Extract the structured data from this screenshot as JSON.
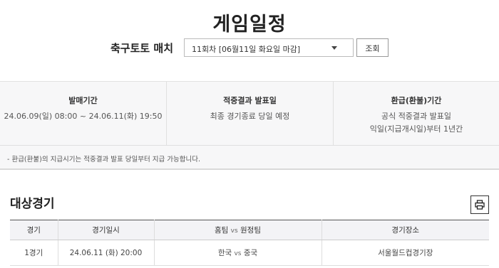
{
  "page": {
    "title": "게임일정"
  },
  "match_select": {
    "label": "축구토토 매치",
    "selected_round": "11회차 [06월11일 화요일 마감]",
    "lookup_button": "조회"
  },
  "info": {
    "sale_period": {
      "title": "발매기간",
      "value": "24.06.09(일) 08:00 ~ 24.06.11(화) 19:50"
    },
    "result_announcement": {
      "title": "적중결과 발표일",
      "value": "최종 경기종료 당일 예정"
    },
    "refund_period": {
      "title": "환급(환불)기간",
      "line1": "공식 적중결과 발표일",
      "line2": "익일(지급개시일)부터 1년간"
    },
    "notice": "- 환급(환불)의 지급시기는 적중결과 발표 당일부터 지급 가능합니다."
  },
  "games": {
    "title": "대상경기",
    "print_icon": "printer-icon",
    "headers": {
      "game": "경기",
      "datetime": "경기일시",
      "home": "홈팀",
      "vs": "vs",
      "away": "원정팀",
      "venue": "경기장소"
    },
    "rows": [
      {
        "game": "1경기",
        "datetime": "24.06.11 (화) 20:00",
        "home": "한국",
        "vs": "vs",
        "away": "중국",
        "venue": "서울월드컵경기장"
      }
    ]
  }
}
